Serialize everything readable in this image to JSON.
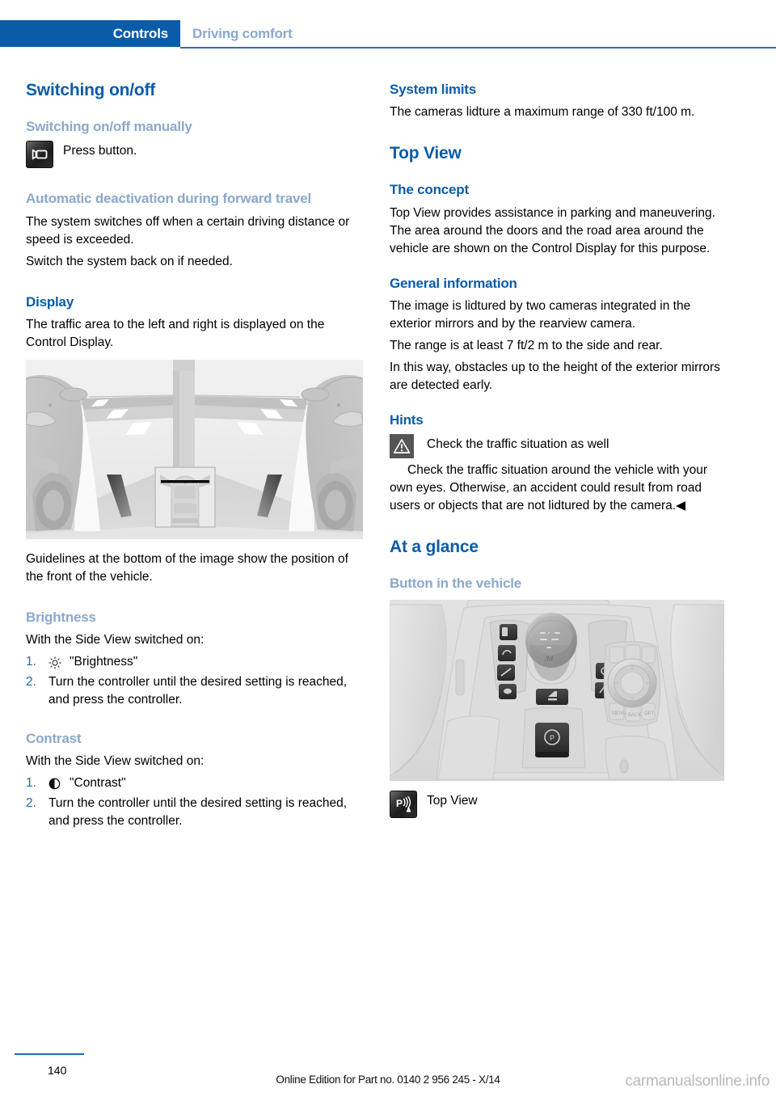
{
  "header": {
    "active_tab": "Controls",
    "inactive_tab": "Driving comfort",
    "accent_color": "#0a5ca8",
    "muted_color": "#8ba8cc"
  },
  "left_column": {
    "title": "Switching on/off",
    "manual_heading": "Switching on/off manually",
    "press_button_icon": "camera-button-icon",
    "press_button_text": "Press button.",
    "auto_deactivation_heading": "Automatic deactivation during forward travel",
    "auto_deactivation_p1": "The system switches off when a certain driving distance or speed is exceeded.",
    "auto_deactivation_p2": "Switch the system back on if needed.",
    "display_heading": "Display",
    "display_p1": "The traffic area to the left and right is displayed on the Control Display.",
    "figure_caption_label": "side-view-camera-display-illustration",
    "display_p2": "Guidelines at the bottom of the image show the position of the front of the vehicle.",
    "brightness_heading": "Brightness",
    "brightness_intro": "With the Side View switched on:",
    "brightness_steps": [
      {
        "num": "1.",
        "glyph": "sun-icon",
        "text": "\"Brightness\""
      },
      {
        "num": "2.",
        "glyph": "",
        "text": "Turn the controller until the desired setting is reached, and press the controller."
      }
    ],
    "contrast_heading": "Contrast",
    "contrast_intro": "With the Side View switched on:",
    "contrast_steps": [
      {
        "num": "1.",
        "glyph": "contrast-icon",
        "text": "\"Contrast\""
      },
      {
        "num": "2.",
        "glyph": "",
        "text": "Turn the controller until the desired setting is reached, and press the controller."
      }
    ]
  },
  "right_column": {
    "system_limits_heading": "System limits",
    "system_limits_p1": "The cameras lidture a maximum range of 330 ft/100 m.",
    "top_view_title": "Top View",
    "concept_heading": "The concept",
    "concept_p1": "Top View provides assistance in parking and maneuvering. The area around the doors and the road area around the vehicle are shown on the Control Display for this purpose.",
    "general_info_heading": "General information",
    "general_info_p1": "The image is lidtured by two cameras integrated in the exterior mirrors and by the rearview camera.",
    "general_info_p2": "The range is at least 7 ft/2 m to the side and rear.",
    "general_info_p3": "In this way, obstacles up to the height of the exterior mirrors are detected early.",
    "hints_heading": "Hints",
    "warning_icon": "warning-triangle-icon",
    "warning_title": "Check the traffic situation as well",
    "warning_body": "Check the traffic situation around the vehicle with your own eyes. Otherwise, an accident could result from road users or objects that are not lidtured by the camera.◀",
    "at_a_glance_heading": "At a glance",
    "button_in_vehicle_heading": "Button in the vehicle",
    "console_figure_label": "center-console-photo",
    "top_view_button_icon": "park-assist-button-icon",
    "top_view_button_label": "Top View"
  },
  "footer": {
    "page_number": "140",
    "edition_text": "Online Edition for Part no. 0140 2 956 245 - X/14",
    "watermark": "carmanualsonline.info"
  }
}
